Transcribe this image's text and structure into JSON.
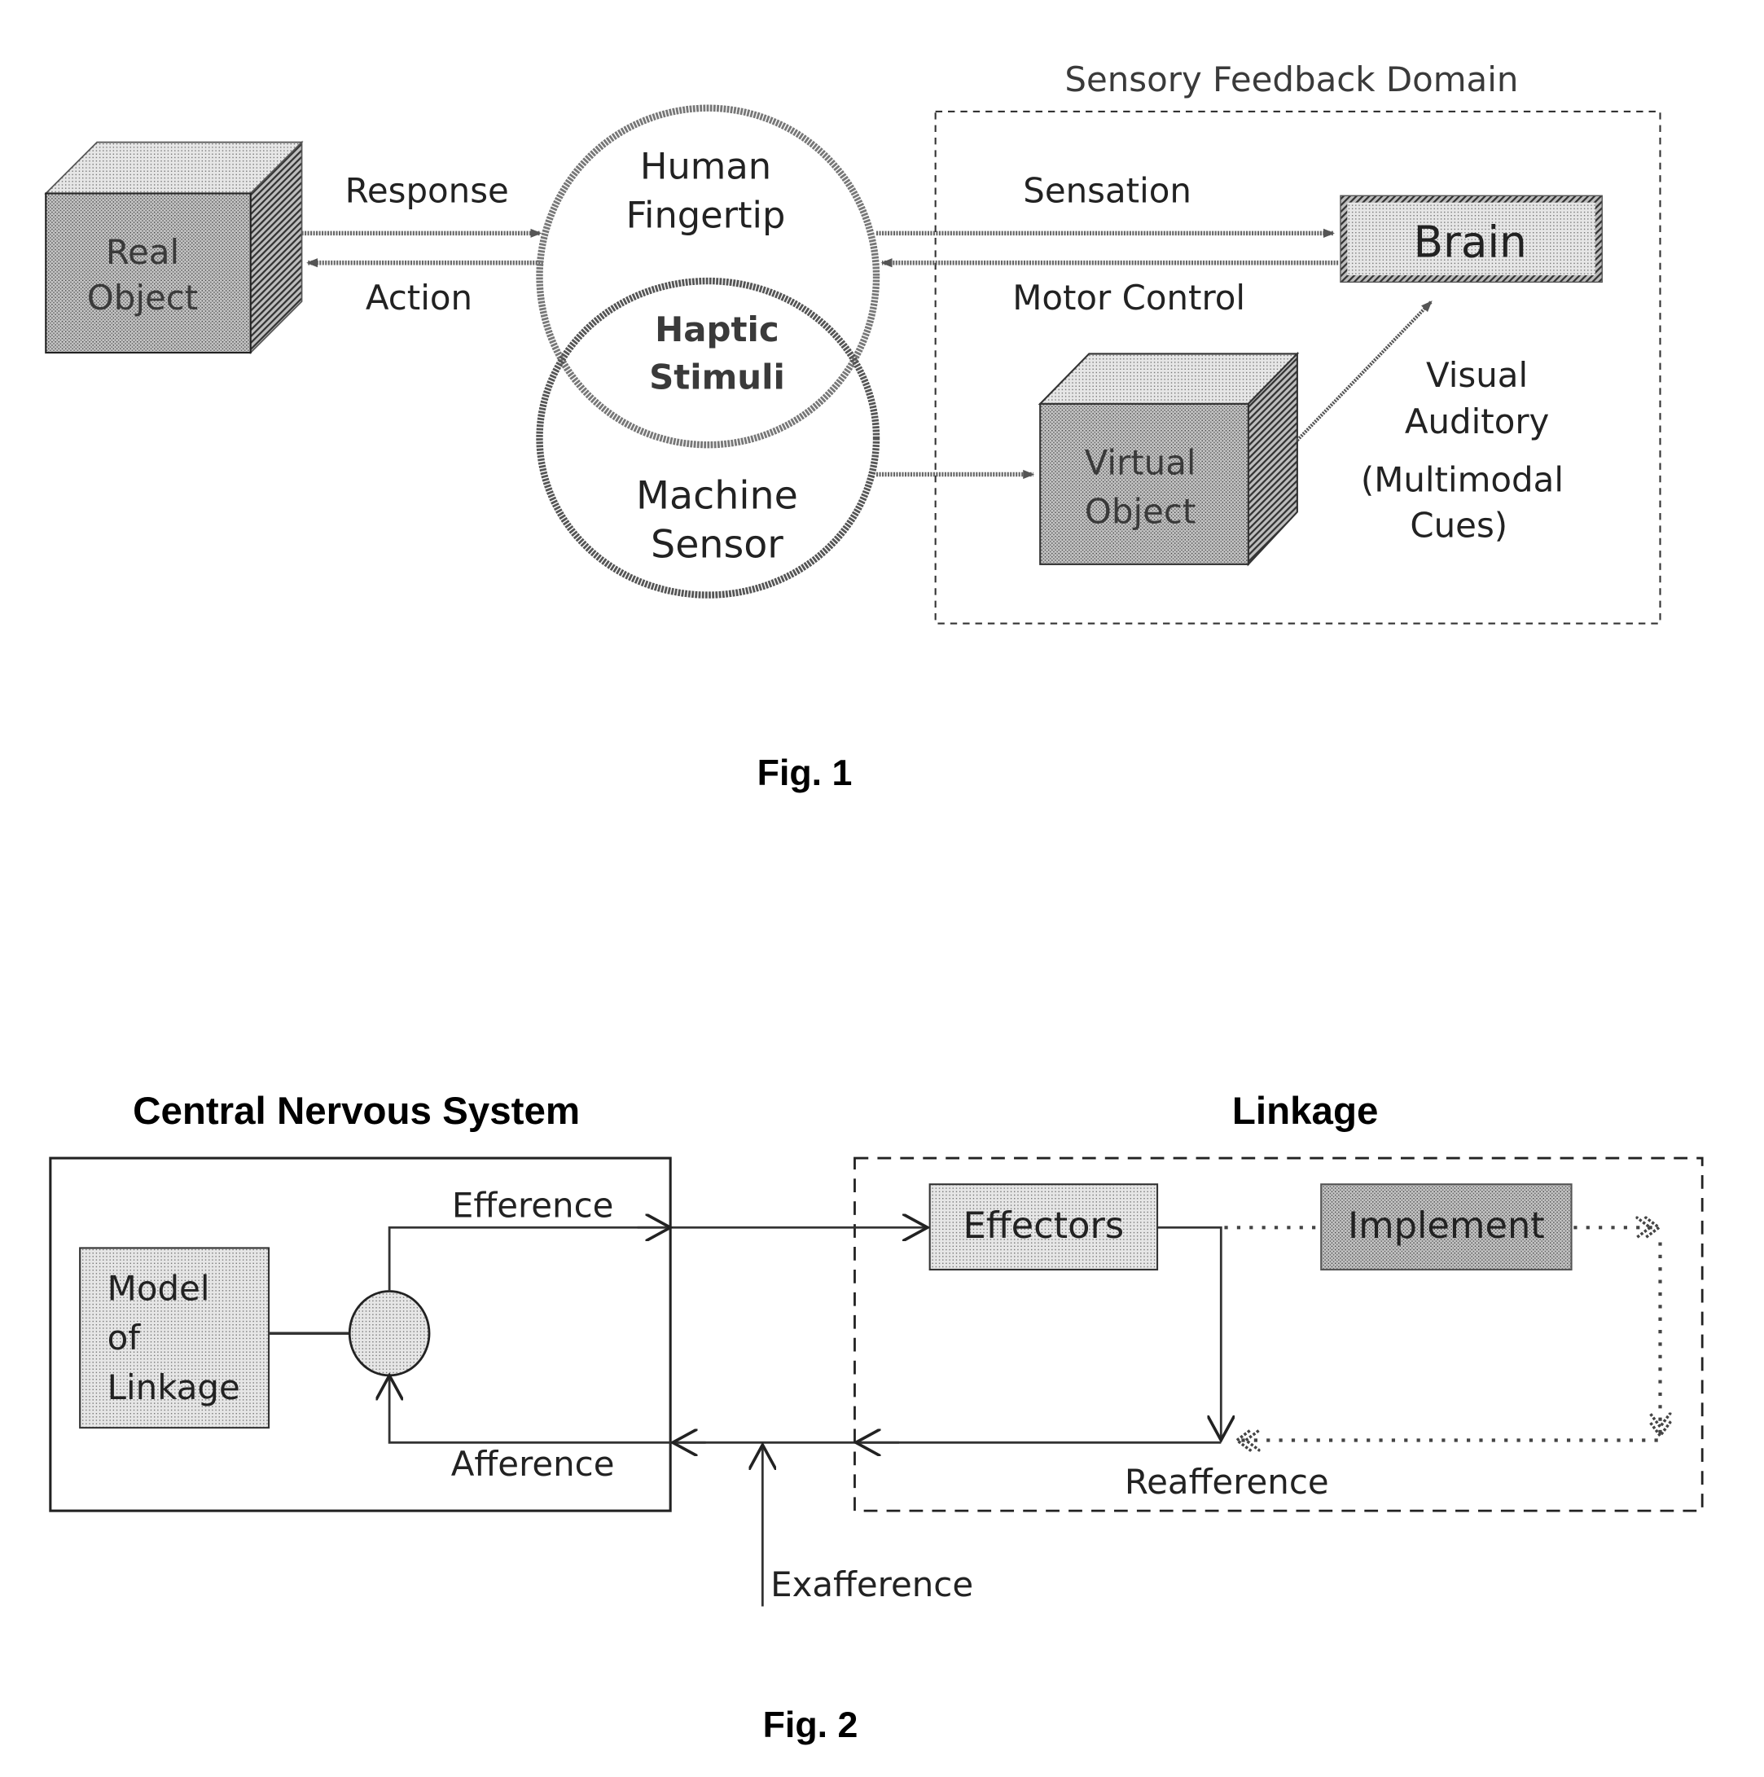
{
  "figure1": {
    "caption": "Fig. 1",
    "domain_label": "Sensory Feedback Domain",
    "real_object": [
      "Real",
      "Object"
    ],
    "response": "Response",
    "action": "Action",
    "human_fingertip": [
      "Human",
      "Fingertip"
    ],
    "haptic_stimuli": [
      "Haptic",
      "Stimuli"
    ],
    "machine_sensor": [
      "Machine",
      "Sensor"
    ],
    "sensation": "Sensation",
    "motor_control": "Motor Control",
    "brain": "Brain",
    "virtual_object": [
      "Virtual",
      "Object"
    ],
    "cues": [
      "Visual",
      "Auditory",
      "(Multimodal",
      "Cues)"
    ]
  },
  "figure2": {
    "caption": "Fig. 2",
    "cns_title": "Central Nervous System",
    "linkage_title": "Linkage",
    "model_of_linkage": [
      "Model",
      "of",
      "Linkage"
    ],
    "efference": "Efference",
    "afference": "Afference",
    "exafference": "Exafference",
    "effectors": "Effectors",
    "implement": "Implement",
    "reafference": "Reafference"
  }
}
